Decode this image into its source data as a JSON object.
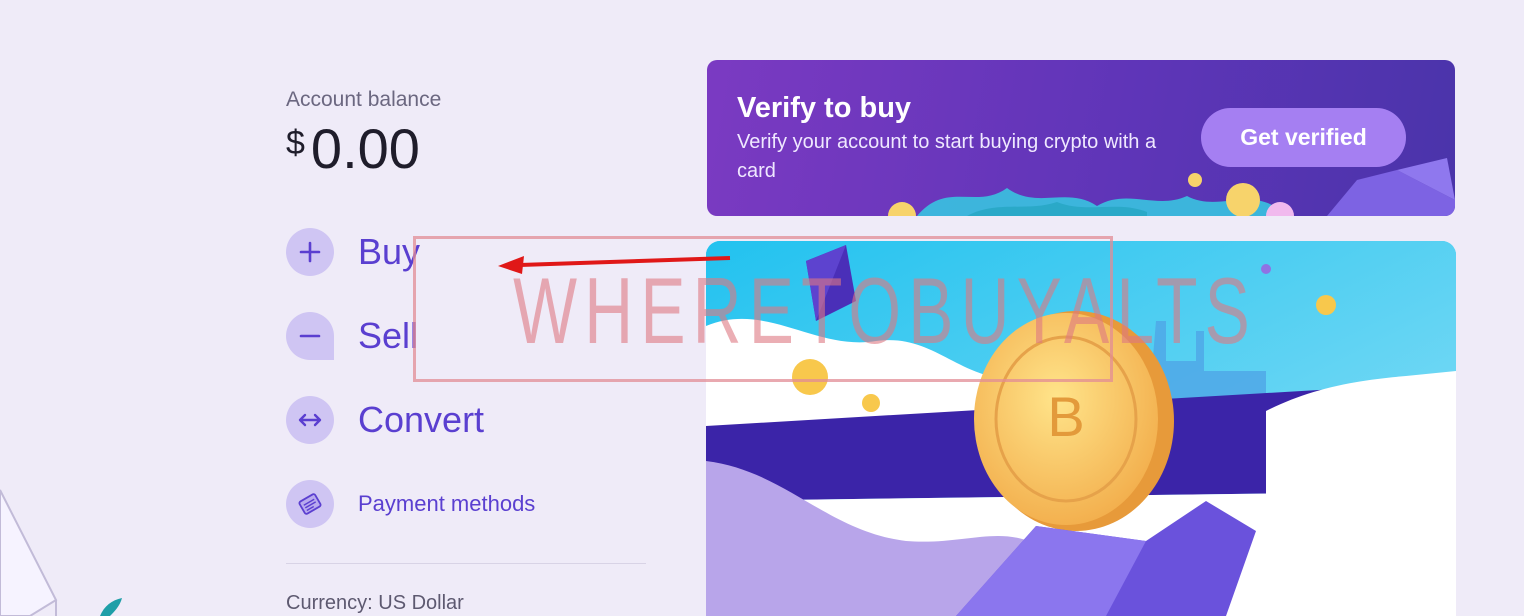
{
  "balance": {
    "label": "Account balance",
    "currency_symbol": "$",
    "amount": "0.00"
  },
  "actions": [
    {
      "label": "Buy",
      "icon": "plus-icon"
    },
    {
      "label": "Sell",
      "icon": "minus-icon"
    },
    {
      "label": "Convert",
      "icon": "swap-arrows-icon"
    },
    {
      "label": "Payment methods",
      "icon": "card-icon"
    }
  ],
  "currency": {
    "text": "Currency: US Dollar"
  },
  "verify": {
    "title": "Verify to buy",
    "text": "Verify your account to start buying crypto with a card",
    "button": "Get verified"
  },
  "hero": {
    "icon": "bitcoin-coin-illustration"
  },
  "watermark": {
    "text": "WHERETOBUYALTS"
  },
  "colors": {
    "page_bg": "#efebf8",
    "accent": "#5a3fd0",
    "action_circle": "#cfc5f3",
    "verify_btn": "#a57ff2",
    "annotation_arrow": "#e01818"
  }
}
